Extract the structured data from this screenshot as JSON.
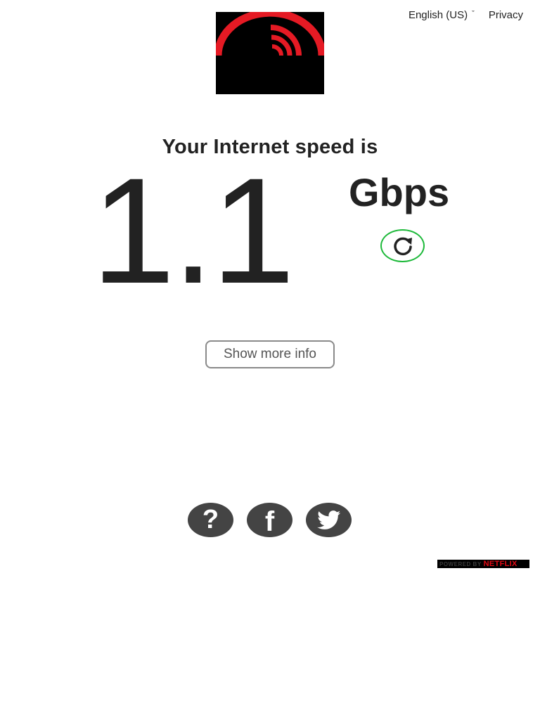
{
  "header": {
    "language_label": "English (US)",
    "language_chevron": "ˇ",
    "privacy_label": "Privacy"
  },
  "logo": {
    "icon": "fast-speed-logo-icon",
    "accent_color": "#e51a24"
  },
  "speed": {
    "headline": "Your Internet speed is",
    "value": "1.1",
    "units": "Gbps",
    "refresh_icon": "refresh-icon",
    "refresh_color": "#1db93a"
  },
  "actions": {
    "show_more_label": "Show more info"
  },
  "social": {
    "help_icon": "question-icon",
    "help_glyph": "?",
    "facebook_icon": "facebook-icon",
    "facebook_glyph": "f",
    "twitter_icon": "twitter-icon"
  },
  "footer": {
    "powered_by": "POWERED BY",
    "brand": "NETFLIX",
    "brand_color": "#e50914"
  }
}
